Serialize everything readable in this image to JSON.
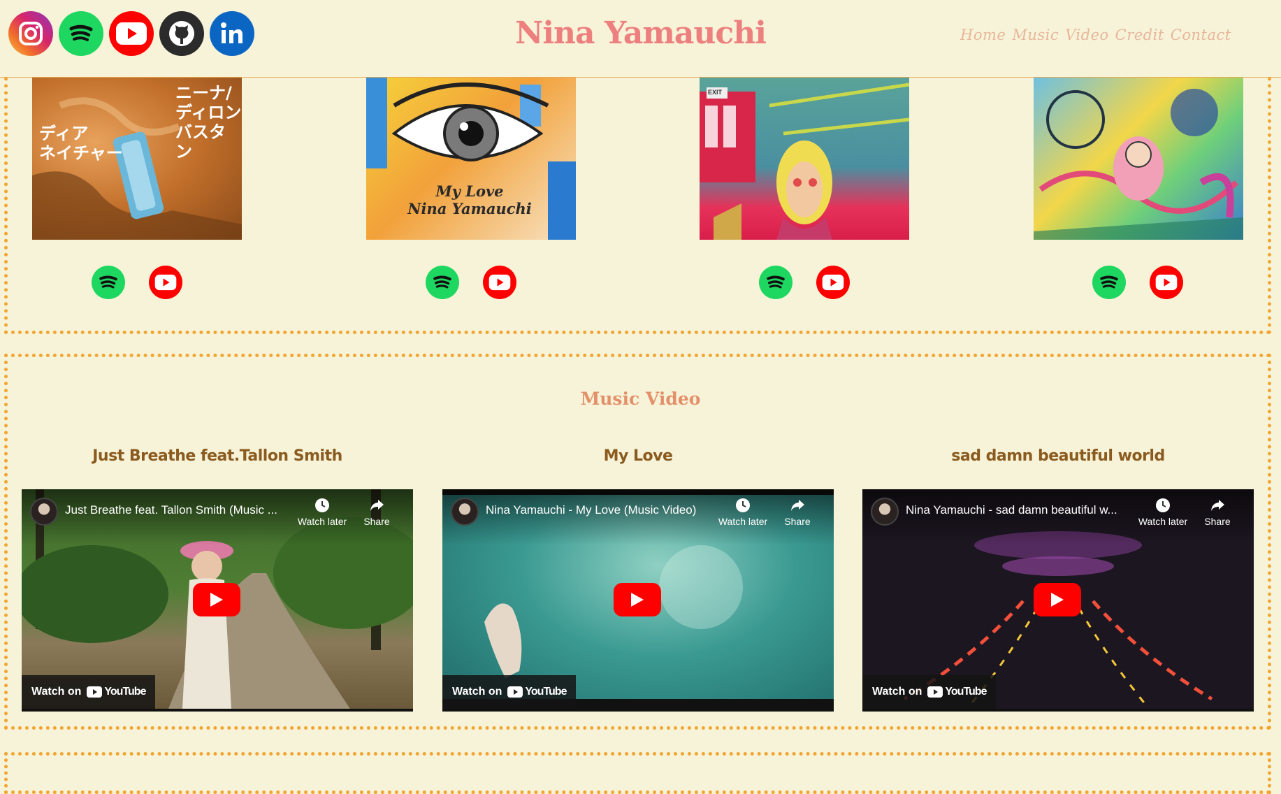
{
  "header": {
    "site_title": "Nina Yamauchi",
    "social_icons": [
      "instagram-icon",
      "spotify-icon",
      "youtube-icon",
      "github-icon",
      "linkedin-icon"
    ],
    "nav": [
      "Home",
      "Music",
      "Video",
      "Credit",
      "Contact"
    ]
  },
  "albums": [
    {
      "art_text": [
        "ニーナ/",
        "ディロン",
        "バスタン"
      ],
      "art_text2": [
        "ディア",
        "ネイチャー"
      ]
    },
    {
      "caption": [
        "My Love",
        "Nina Yamauchi"
      ]
    },
    {
      "sign": "EXIT"
    },
    {}
  ],
  "music_video": {
    "heading": "Music Video",
    "videos": [
      {
        "label": "Just Breathe feat.Tallon Smith",
        "player_title": "Just Breathe feat. Tallon Smith (Music ...",
        "watch_later": "Watch later",
        "share": "Share",
        "watch_on": "Watch on",
        "youtube": "YouTube"
      },
      {
        "label": "My Love",
        "player_title": "Nina Yamauchi - My Love (Music Video)",
        "watch_later": "Watch later",
        "share": "Share",
        "watch_on": "Watch on",
        "youtube": "YouTube"
      },
      {
        "label": "sad damn beautiful world",
        "player_title": "Nina Yamauchi - sad damn beautiful w...",
        "watch_later": "Watch later",
        "share": "Share",
        "watch_on": "Watch on",
        "youtube": "YouTube"
      }
    ]
  },
  "colors": {
    "background": "#f6f3d8",
    "accent_border": "#f2a530",
    "title": "#ee7f7f",
    "nav": "#e8b69b",
    "video_label": "#8a5a1e"
  }
}
